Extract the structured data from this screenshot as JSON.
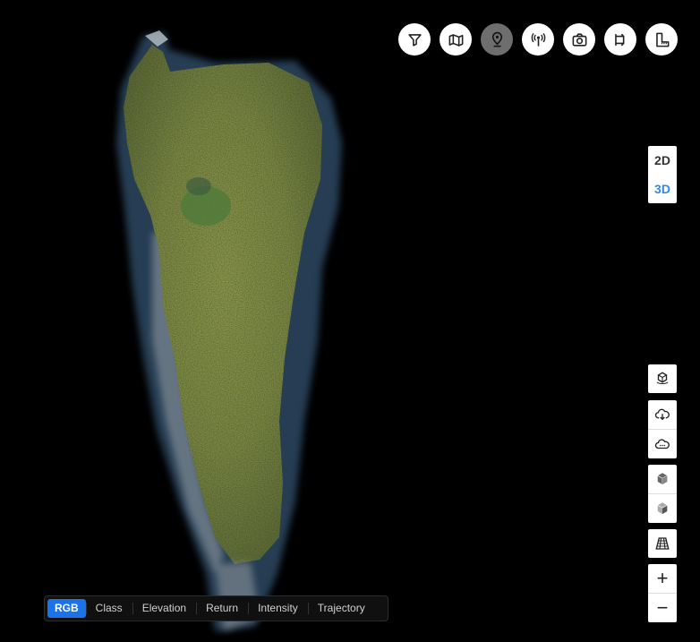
{
  "view_mode": {
    "options": [
      "2D",
      "3D"
    ],
    "selected": "3D"
  },
  "top_tools": [
    {
      "icon": "filter-icon",
      "active": false
    },
    {
      "icon": "map-icon",
      "active": false
    },
    {
      "icon": "location-pin-icon",
      "active": true
    },
    {
      "icon": "antenna-icon",
      "active": false
    },
    {
      "icon": "camera-icon",
      "active": false
    },
    {
      "icon": "route-icon",
      "active": false
    },
    {
      "icon": "measure-icon",
      "active": false
    }
  ],
  "right_tools": [
    {
      "icon": "cube-rotate-icon"
    },
    {
      "icon": "cloud-download-icon"
    },
    {
      "icon": "cloud-settings-icon"
    },
    {
      "icon": "cube-solid-icon"
    },
    {
      "icon": "cube-outline-icon"
    },
    {
      "icon": "grid-perspective-icon"
    }
  ],
  "zoom": {
    "in_label": "+",
    "out_label": "−"
  },
  "color_modes": {
    "tabs": [
      "RGB",
      "Class",
      "Elevation",
      "Return",
      "Intensity",
      "Trajectory"
    ],
    "active": "RGB"
  },
  "colors": {
    "background": "#000000",
    "accent": "#1a73e8",
    "toggle_selected": "#2f8ae8",
    "active_tool": "#6e6e6e"
  }
}
